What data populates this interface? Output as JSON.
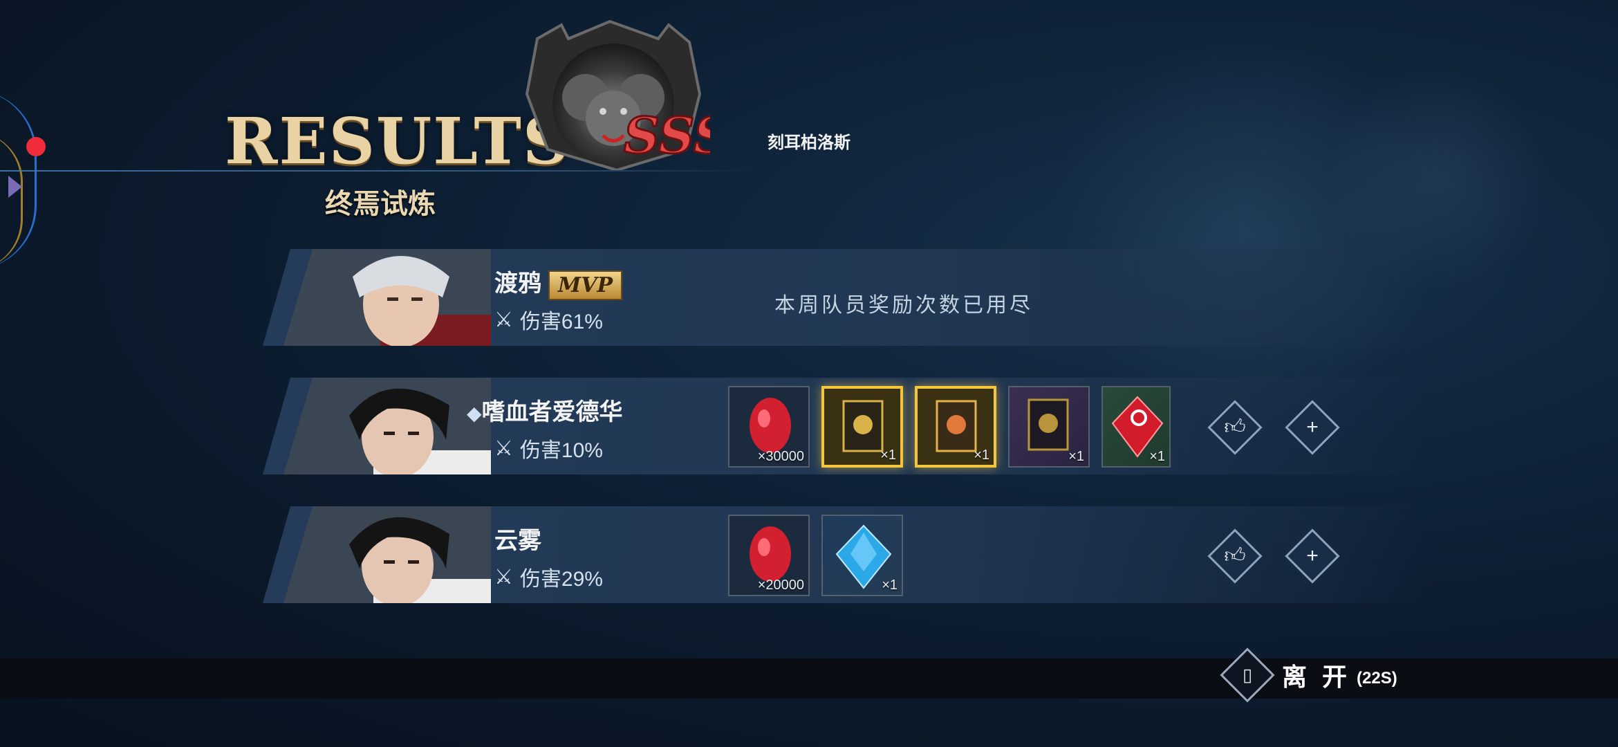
{
  "header": {
    "title": "RESULTS",
    "mode": "终焉试炼",
    "boss_name": "刻耳柏洛斯",
    "boss_rank": "SSS"
  },
  "players": [
    {
      "name": "渡鸦",
      "mvp_label": "MVP",
      "damage": "伤害61%",
      "notice": "本周队员奖励次数已用尽",
      "rewards": []
    },
    {
      "name": "嗜血者爱德华",
      "damage": "伤害10%",
      "rewards": [
        {
          "item": "red-orb",
          "qty": "×30000"
        },
        {
          "item": "gold-card",
          "qty": "×1"
        },
        {
          "item": "gold-card-flame",
          "qty": "×1"
        },
        {
          "item": "purple-card",
          "qty": "×1"
        },
        {
          "item": "red-crystal",
          "qty": "×1"
        }
      ]
    },
    {
      "name": "云雾",
      "damage": "伤害29%",
      "rewards": [
        {
          "item": "red-orb",
          "qty": "×20000"
        },
        {
          "item": "blue-crystal",
          "qty": "×1"
        }
      ]
    }
  ],
  "footer": {
    "leave_label": "离 开",
    "leave_timer": "(22S)"
  },
  "colors": {
    "accent_gold": "#f3c63b",
    "title_gold": "#e9d2a4",
    "notify_red": "#f02b3a"
  }
}
